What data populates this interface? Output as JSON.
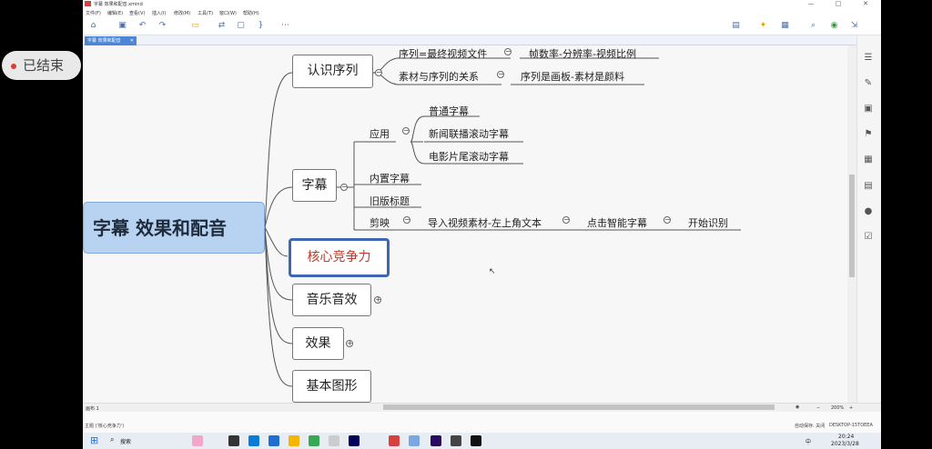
{
  "window": {
    "title": "字幕 效果和配音.xmind",
    "controls": {
      "minimize": "—",
      "maximize": "□",
      "close": "✕"
    }
  },
  "menu": [
    "文件(F)",
    "编辑(E)",
    "查看(V)",
    "插入(I)",
    "修改(M)",
    "工具(T)",
    "窗口(W)",
    "帮助(H)"
  ],
  "tab": {
    "label": "字幕 效果和配音",
    "close": "✕"
  },
  "status_badge": {
    "text": "已结束"
  },
  "mindmap": {
    "root": "字幕 效果和配音",
    "branches": {
      "recognize_sequence": {
        "title": "认识序列",
        "items": [
          {
            "text": "序列=最终视频文件",
            "child": "帧数率-分辨率-视频比例"
          },
          {
            "text": "素材与序列的关系",
            "child": "序列是画板-素材是颜料"
          }
        ]
      },
      "subtitles": {
        "title": "字幕",
        "application": {
          "label": "应用",
          "children": [
            "普通字幕",
            "新闻联播滚动字幕",
            "电影片尾滚动字幕"
          ]
        },
        "builtin": "内置字幕",
        "legacy_title": "旧版标题",
        "jianying": {
          "label": "剪映",
          "step1": "导入视频素材-左上角文本",
          "step2": "点击智能字幕",
          "step3": "开始识别"
        }
      },
      "core": {
        "title": "核心竞争力"
      },
      "music": {
        "title": "音乐音效"
      },
      "effects": {
        "title": "效果"
      },
      "shapes": {
        "title": "基本图形"
      }
    },
    "expand_symbol": "+",
    "collapse_symbol": "−"
  },
  "bottom": {
    "sheet_label": "画布 1",
    "zoom": "200%"
  },
  "statusbar": {
    "selected": "主题 ('核心竞争力')",
    "autosave": "自动保存: 关闭",
    "computer": "DESKTOP-15TOEEA"
  },
  "taskbar": {
    "search_placeholder": "搜索",
    "time": "20:24",
    "date": "2023/3/28",
    "ime": "中"
  }
}
